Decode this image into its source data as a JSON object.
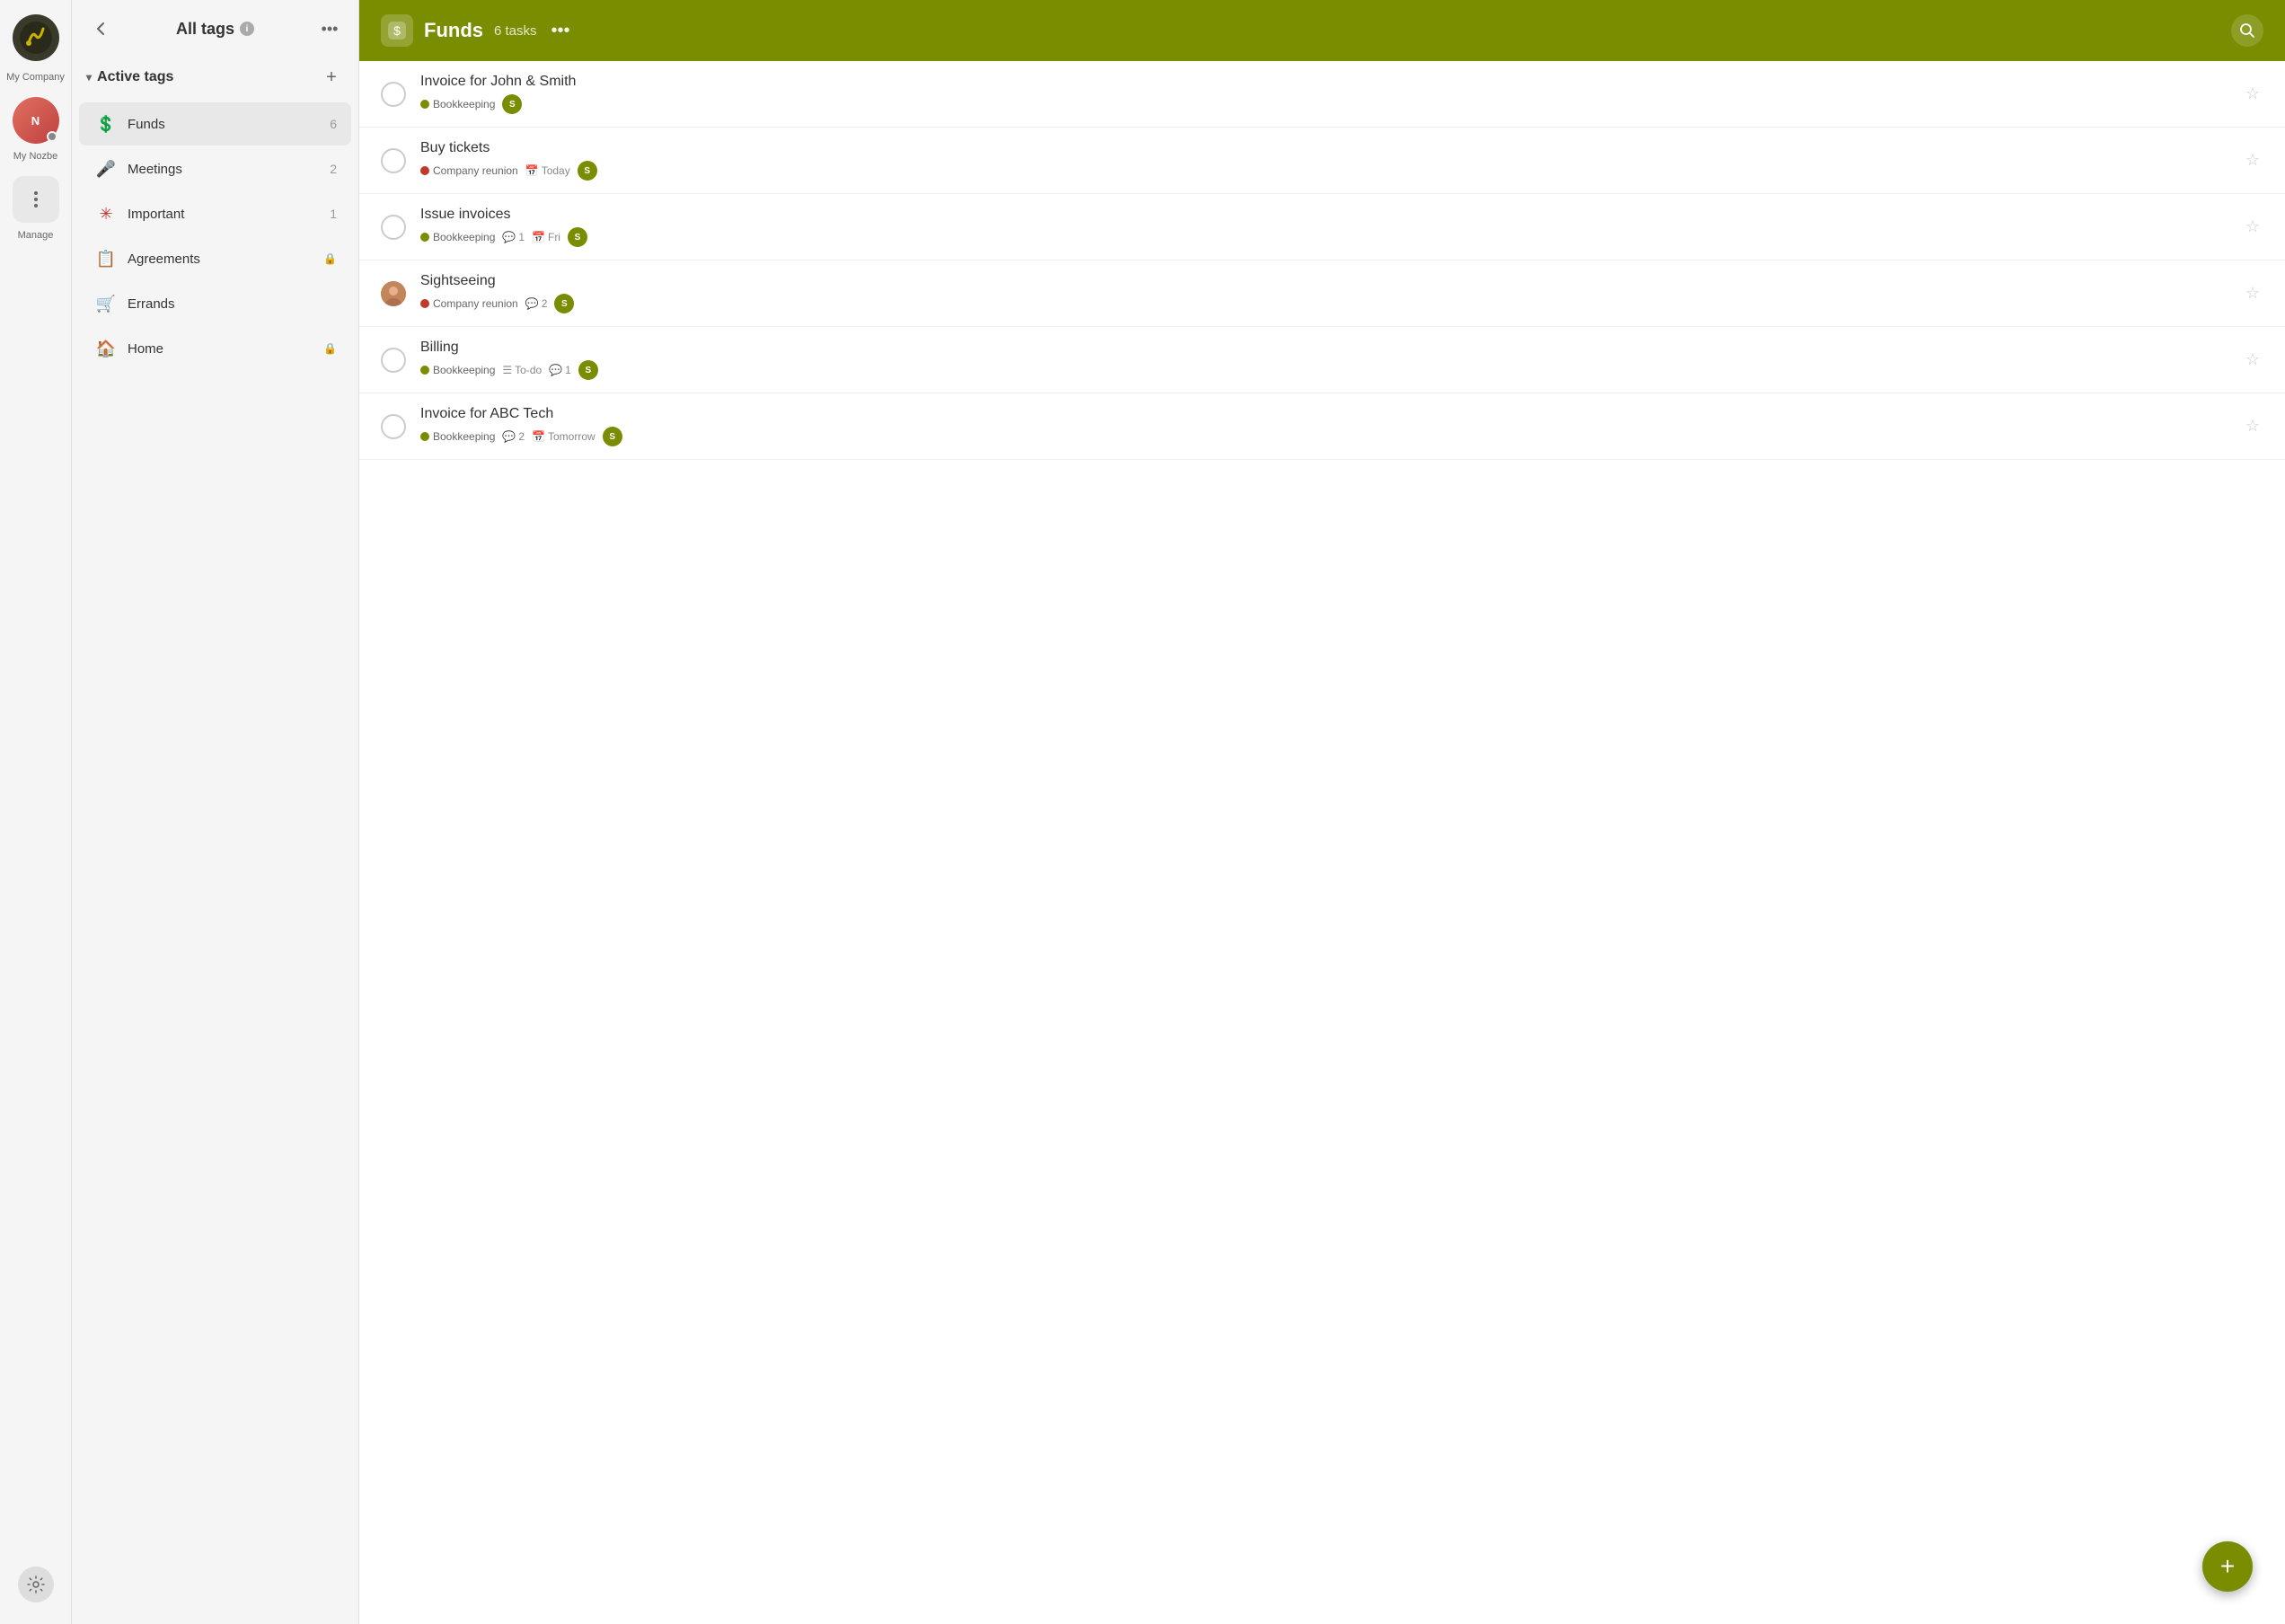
{
  "app": {
    "company": "My Company",
    "user_label": "My Nozbe"
  },
  "sidebar": {
    "title": "All tags",
    "back_label": "‹",
    "more_label": "•••",
    "add_label": "+",
    "active_tags_label": "Active tags",
    "tags": [
      {
        "id": "funds",
        "name": "Funds",
        "icon": "💲",
        "icon_color": "#7a8c00",
        "count": 6,
        "active": true
      },
      {
        "id": "meetings",
        "name": "Meetings",
        "icon": "🎤",
        "icon_color": "#555",
        "count": 2,
        "active": false
      },
      {
        "id": "important",
        "name": "Important",
        "icon": "❇️",
        "icon_color": "#c0392b",
        "count": 1,
        "active": false
      },
      {
        "id": "agreements",
        "name": "Agreements",
        "icon": "📋",
        "icon_color": "#5b7fa6",
        "count": null,
        "active": false,
        "locked": true
      },
      {
        "id": "errands",
        "name": "Errands",
        "icon": "🛒",
        "icon_color": "#e08c00",
        "count": null,
        "active": false
      },
      {
        "id": "home",
        "name": "Home",
        "icon": "🏠",
        "icon_color": "#7a8c00",
        "count": null,
        "active": false,
        "locked": true
      }
    ]
  },
  "main": {
    "header": {
      "title": "Funds",
      "task_count": "6 tasks",
      "more_label": "•••"
    },
    "tasks": [
      {
        "id": "task1",
        "title": "Invoice for John & Smith",
        "project": "Bookkeeping",
        "project_color": "green",
        "date": null,
        "date_label": null,
        "comments": null,
        "user_initial": "S",
        "has_avatar": false
      },
      {
        "id": "task2",
        "title": "Buy tickets",
        "project": "Company reunion",
        "project_color": "red",
        "date_label": "Today",
        "date_icon": "📅",
        "comments": null,
        "user_initial": "S",
        "has_avatar": false
      },
      {
        "id": "task3",
        "title": "Issue invoices",
        "project": "Bookkeeping",
        "project_color": "green",
        "comments_count": "1",
        "date_label": "Fri",
        "date_icon": "📅",
        "user_initial": "S",
        "has_avatar": false
      },
      {
        "id": "task4",
        "title": "Sightseeing",
        "project": "Company reunion",
        "project_color": "red",
        "comments_count": "2",
        "date": null,
        "date_label": null,
        "user_initial": "S",
        "has_avatar": true
      },
      {
        "id": "task5",
        "title": "Billing",
        "project": "Bookkeeping",
        "project_color": "green",
        "sub_label": "To-do",
        "comments_count": "1",
        "date": null,
        "date_label": null,
        "user_initial": "S",
        "has_avatar": false
      },
      {
        "id": "task6",
        "title": "Invoice for ABC Tech",
        "project": "Bookkeeping",
        "project_color": "green",
        "comments_count": "2",
        "date_label": "Tomorrow",
        "date_icon": "📅",
        "user_initial": "S",
        "has_avatar": false
      }
    ]
  },
  "fab": {
    "label": "+"
  },
  "icons": {
    "back": "‹",
    "more": "•••",
    "add": "+",
    "star": "☆",
    "search": "🔍",
    "calendar": "📅",
    "comments": "💬",
    "checklist": "☰",
    "info": "i",
    "lock": "🔒"
  },
  "colors": {
    "header_bg": "#7a8c00",
    "accent": "#7a8c00",
    "tag_red": "#c0392b",
    "tag_green": "#7a8c00"
  }
}
